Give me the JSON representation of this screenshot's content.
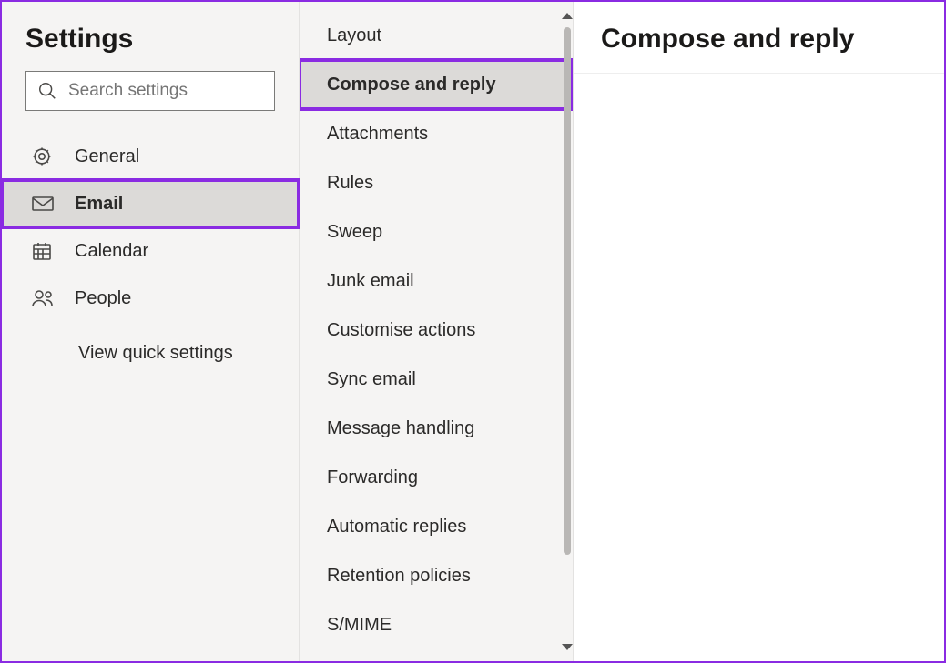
{
  "header": {
    "title": "Settings"
  },
  "search": {
    "placeholder": "Search settings"
  },
  "categories": {
    "items": [
      {
        "label": "General"
      },
      {
        "label": "Email"
      },
      {
        "label": "Calendar"
      },
      {
        "label": "People"
      }
    ],
    "view_quick": "View quick settings"
  },
  "subsettings": {
    "items": [
      {
        "label": "Layout"
      },
      {
        "label": "Compose and reply"
      },
      {
        "label": "Attachments"
      },
      {
        "label": "Rules"
      },
      {
        "label": "Sweep"
      },
      {
        "label": "Junk email"
      },
      {
        "label": "Customise actions"
      },
      {
        "label": "Sync email"
      },
      {
        "label": "Message handling"
      },
      {
        "label": "Forwarding"
      },
      {
        "label": "Automatic replies"
      },
      {
        "label": "Retention policies"
      },
      {
        "label": "S/MIME"
      }
    ]
  },
  "detail": {
    "title": "Compose and reply"
  }
}
